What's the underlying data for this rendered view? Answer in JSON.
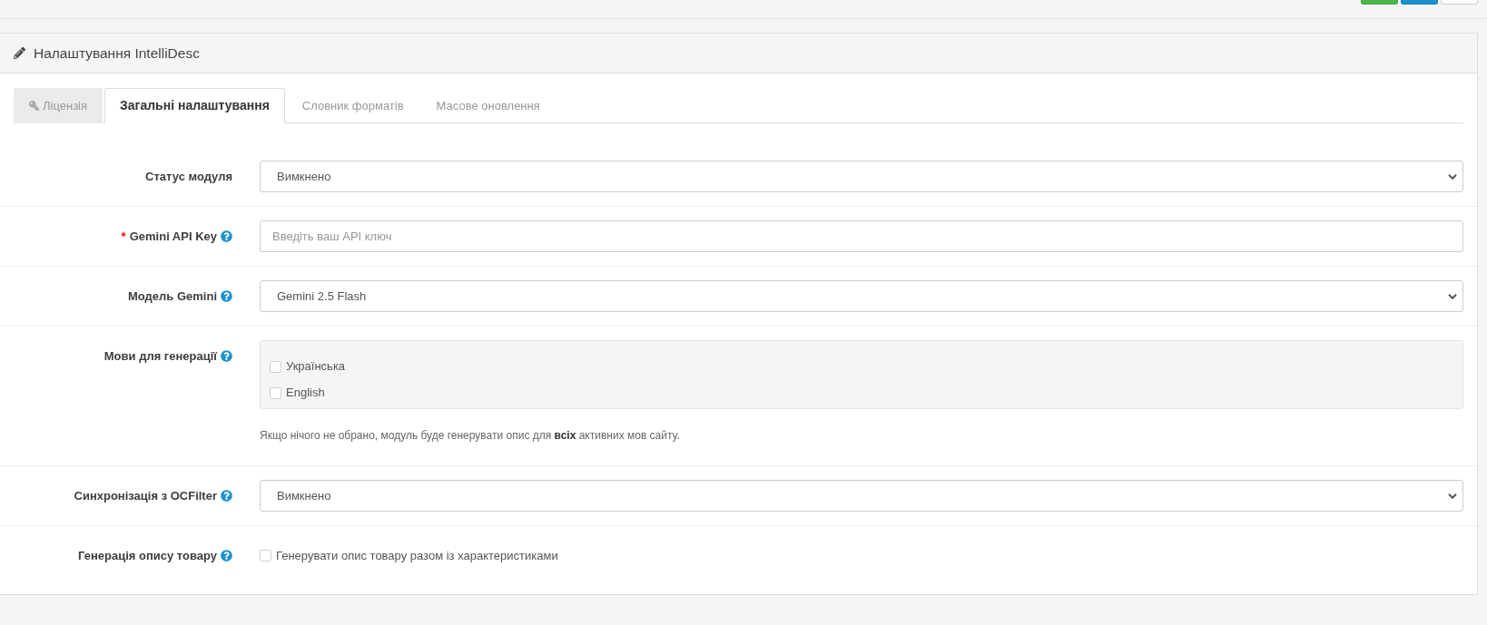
{
  "toolbar": {
    "buttons": [
      {
        "kind": "success"
      },
      {
        "kind": "primary"
      },
      {
        "kind": "default"
      }
    ]
  },
  "panel": {
    "title": "Налаштування IntelliDesc"
  },
  "tabs": [
    {
      "label": "Ліцензія",
      "selected": false,
      "disabled": true,
      "has_icon": true
    },
    {
      "label": "Загальні налаштування",
      "selected": true,
      "disabled": false,
      "has_icon": false
    },
    {
      "label": "Словник форматів",
      "selected": false,
      "disabled": false,
      "has_icon": false
    },
    {
      "label": "Масове оновлення",
      "selected": false,
      "disabled": false,
      "has_icon": false
    }
  ],
  "form": {
    "rows": [
      {
        "kind": "select",
        "label": "Статус модуля",
        "has_help": false,
        "value": "Вимкнено"
      },
      {
        "kind": "input",
        "required_mark": "*",
        "label": "Gemini API Key",
        "has_help": true,
        "placeholder": "Введіть ваш API ключ"
      },
      {
        "kind": "select",
        "label": "Модель Gemini",
        "has_help": true,
        "value": "Gemini 2.5 Flash"
      },
      {
        "kind": "checklist",
        "label": "Мови для генерації",
        "has_help": true,
        "options": [
          {
            "label": "Українська",
            "checked": false
          },
          {
            "label": "English",
            "checked": false
          }
        ],
        "note": "Якщо нічого не обрано, модуль буде генерувати опис для **всіх** активних мов сайту."
      },
      {
        "kind": "select",
        "label": "Синхронізація з OCFilter",
        "has_help": true,
        "value": "Вимкнено"
      },
      {
        "kind": "checkbox",
        "label": "Генерація опису товару",
        "has_help": true,
        "checked": false,
        "text": "Генерувати опис товару разом із характеристиками"
      }
    ]
  }
}
